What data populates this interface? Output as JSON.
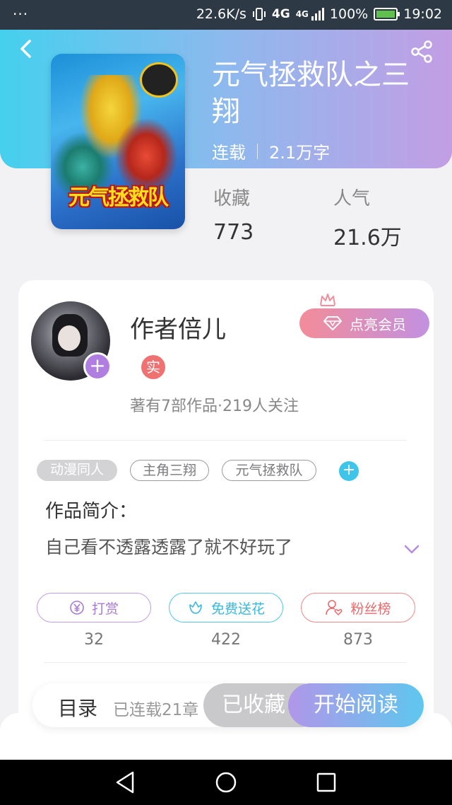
{
  "status_bar": {
    "dots": "···",
    "speed": "22.6K/s",
    "network": "4G",
    "network_small": "4G",
    "battery": "100%",
    "time": "19:02"
  },
  "book": {
    "title": "元气拯救队之三翔",
    "serial_status": "连载",
    "word_count": "2.1万字",
    "cover_logo": "元气拯救队",
    "favorites_label": "收藏",
    "favorites_value": "773",
    "popularity_label": "人气",
    "popularity_value": "21.6万"
  },
  "author": {
    "name": "作者倍儿",
    "real_badge": "实",
    "info": "著有7部作品·219人关注",
    "follow_symbol": "+"
  },
  "vip": {
    "label": "点亮会员"
  },
  "tags": [
    "动漫同人",
    "主角三翔",
    "元气拯救队"
  ],
  "tag_add_symbol": "+",
  "intro": {
    "heading": "作品简介：",
    "text": "自己看不透露透露了就不好玩了"
  },
  "actions": [
    {
      "label": "打赏",
      "count": "32"
    },
    {
      "label": "免费送花",
      "count": "422"
    },
    {
      "label": "粉丝榜",
      "count": "873"
    }
  ],
  "bottom": {
    "toc_label": "目录",
    "toc_status": "已连载21章",
    "collected_label": "已收藏",
    "read_label": "开始阅读"
  },
  "colors": {
    "header_start": "#45d0ee",
    "header_end": "#c39ee4",
    "accent_purple": "#b07ee0",
    "accent_cyan": "#3fc5ea",
    "accent_red": "#f07172"
  },
  "icons": [
    "back-icon",
    "share-icon",
    "diamond-icon",
    "crown-icon",
    "yen-icon",
    "flower-icon",
    "user-heart-icon",
    "chevron-down-icon",
    "nav-back-icon",
    "nav-home-icon",
    "nav-recent-icon"
  ]
}
